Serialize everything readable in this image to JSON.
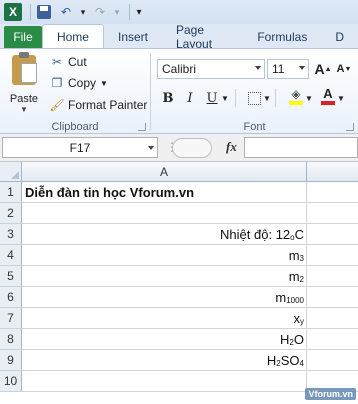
{
  "qat": {
    "undo_arrow": "▾",
    "redo_arrow": "▾",
    "customize": "▾"
  },
  "tabs": [
    "File",
    "Home",
    "Insert",
    "Page Layout",
    "Formulas",
    "D"
  ],
  "clipboard": {
    "paste": "Paste",
    "cut": "Cut",
    "copy": "Copy",
    "format_painter": "Format Painter",
    "label": "Clipboard"
  },
  "font": {
    "name": "Calibri",
    "size": "11",
    "bold": "B",
    "italic": "I",
    "underline": "U",
    "label": "Font",
    "grow": "A",
    "shrink": "A",
    "highlight_color": "#ffff00",
    "font_color": "#e02020"
  },
  "formula_bar": {
    "cell_ref": "F17",
    "fx": "fx",
    "formula": ""
  },
  "columns": [
    "A"
  ],
  "rows": [
    {
      "num": "1",
      "align": "left",
      "bold": true,
      "parts": [
        {
          "t": "Diễn đàn tin học Vforum.vn"
        }
      ]
    },
    {
      "num": "2",
      "align": "left",
      "bold": false,
      "parts": []
    },
    {
      "num": "3",
      "align": "right",
      "bold": false,
      "parts": [
        {
          "t": "Nhiệt độ: 12"
        },
        {
          "t": "o",
          "sup": true
        },
        {
          "t": "C"
        }
      ]
    },
    {
      "num": "4",
      "align": "right",
      "bold": false,
      "parts": [
        {
          "t": "m"
        },
        {
          "t": "3",
          "sup": true
        }
      ]
    },
    {
      "num": "5",
      "align": "right",
      "bold": false,
      "parts": [
        {
          "t": "m"
        },
        {
          "t": "2",
          "sup": true
        }
      ]
    },
    {
      "num": "6",
      "align": "right",
      "bold": false,
      "parts": [
        {
          "t": "m"
        },
        {
          "t": "1000",
          "sup": true
        }
      ]
    },
    {
      "num": "7",
      "align": "right",
      "bold": false,
      "parts": [
        {
          "t": "x"
        },
        {
          "t": "y",
          "sup": true
        }
      ]
    },
    {
      "num": "8",
      "align": "right",
      "bold": false,
      "parts": [
        {
          "t": "H"
        },
        {
          "t": "2",
          "sub": true
        },
        {
          "t": "O"
        }
      ]
    },
    {
      "num": "9",
      "align": "right",
      "bold": false,
      "parts": [
        {
          "t": "H"
        },
        {
          "t": "2",
          "sub": true
        },
        {
          "t": "SO"
        },
        {
          "t": "4",
          "sub": true
        }
      ]
    },
    {
      "num": "10",
      "align": "left",
      "bold": false,
      "parts": []
    }
  ],
  "watermark": "Vforum.vn"
}
